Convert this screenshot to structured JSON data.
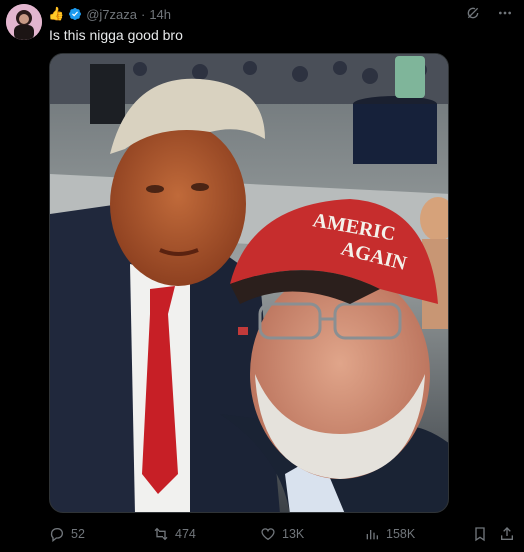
{
  "author": {
    "emoji": "👍",
    "handle": "@j7zaza",
    "separator": "·",
    "time": "14h"
  },
  "tweet": {
    "text": "Is this nigga good bro"
  },
  "media": {
    "cap_text_line1": "AMERIC",
    "cap_text_line2": "AGAIN"
  },
  "actions": {
    "replies": "52",
    "reposts": "474",
    "likes": "13K",
    "views": "158K"
  },
  "colors": {
    "background": "#000000",
    "text": "#e7e9ea",
    "muted": "#71767b",
    "verified": "#1d9bf0"
  }
}
